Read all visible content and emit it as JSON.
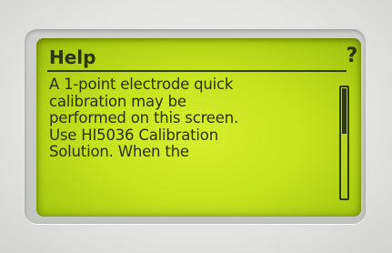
{
  "screen": {
    "title": "Help",
    "help_symbol": "?",
    "body_lines": [
      "A 1-point electrode quick",
      "calibration may be",
      "performed on this screen.",
      "Use HI5036 Calibration",
      "Solution. When the"
    ],
    "scroll_position_fraction": 0.0,
    "scroll_visible_fraction": 0.42
  },
  "colors": {
    "lcd_background": "#c6e31f",
    "lcd_text": "#2a3208",
    "bezel": "#c8c9c6",
    "housing": "#e8e8e6"
  }
}
